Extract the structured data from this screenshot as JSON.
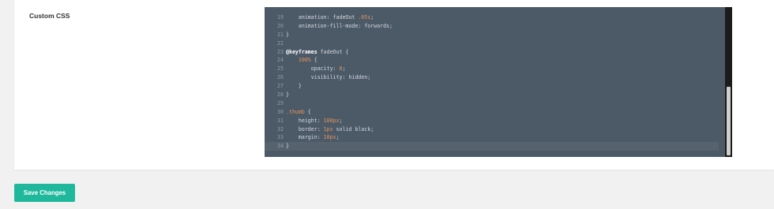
{
  "settings": {
    "field_label": "Custom CSS"
  },
  "editor": {
    "lines": [
      {
        "num": "19",
        "parts": [
          {
            "t": "    animation: ",
            "c": "txt"
          },
          {
            "t": "fadeOut ",
            "c": "txt"
          },
          {
            "t": ".05s",
            "c": "c-num"
          },
          {
            "t": ";",
            "c": "txt"
          }
        ]
      },
      {
        "num": "20",
        "parts": [
          {
            "t": "    animation-fill-mode: forwards;",
            "c": "txt"
          }
        ]
      },
      {
        "num": "21",
        "parts": [
          {
            "t": "}",
            "c": "txt"
          }
        ]
      },
      {
        "num": "22",
        "parts": []
      },
      {
        "num": "23",
        "parts": [
          {
            "t": "@keyframes",
            "c": "c-kw"
          },
          {
            "t": " fadeOut {",
            "c": "txt"
          }
        ]
      },
      {
        "num": "24",
        "parts": [
          {
            "t": "    ",
            "c": "txt"
          },
          {
            "t": "100%",
            "c": "c-num"
          },
          {
            "t": " {",
            "c": "txt"
          }
        ]
      },
      {
        "num": "25",
        "parts": [
          {
            "t": "        opacity: ",
            "c": "txt"
          },
          {
            "t": "0",
            "c": "c-num"
          },
          {
            "t": ";",
            "c": "txt"
          }
        ]
      },
      {
        "num": "26",
        "parts": [
          {
            "t": "        visibility: hidden;",
            "c": "txt"
          }
        ]
      },
      {
        "num": "27",
        "parts": [
          {
            "t": "    }",
            "c": "txt"
          }
        ]
      },
      {
        "num": "28",
        "parts": [
          {
            "t": "}",
            "c": "txt"
          }
        ]
      },
      {
        "num": "29",
        "parts": []
      },
      {
        "num": "30",
        "parts": [
          {
            "t": ".thumb",
            "c": "c-sel"
          },
          {
            "t": " {",
            "c": "txt"
          }
        ]
      },
      {
        "num": "31",
        "parts": [
          {
            "t": "    height: ",
            "c": "txt"
          },
          {
            "t": "100px",
            "c": "c-num"
          },
          {
            "t": ";",
            "c": "txt"
          }
        ]
      },
      {
        "num": "32",
        "parts": [
          {
            "t": "    border: ",
            "c": "txt"
          },
          {
            "t": "1px",
            "c": "c-num"
          },
          {
            "t": " solid black;",
            "c": "txt"
          }
        ]
      },
      {
        "num": "33",
        "parts": [
          {
            "t": "    margin: ",
            "c": "txt"
          },
          {
            "t": "10px",
            "c": "c-num"
          },
          {
            "t": ";",
            "c": "txt"
          }
        ]
      },
      {
        "num": "34",
        "parts": [
          {
            "t": "}",
            "c": "txt"
          }
        ],
        "active": true
      }
    ]
  },
  "actions": {
    "save_label": "Save Changes"
  },
  "colors": {
    "accent": "#1fb89c",
    "editor_bg": "#4c5a68",
    "page_bg": "#f1f1f1"
  }
}
